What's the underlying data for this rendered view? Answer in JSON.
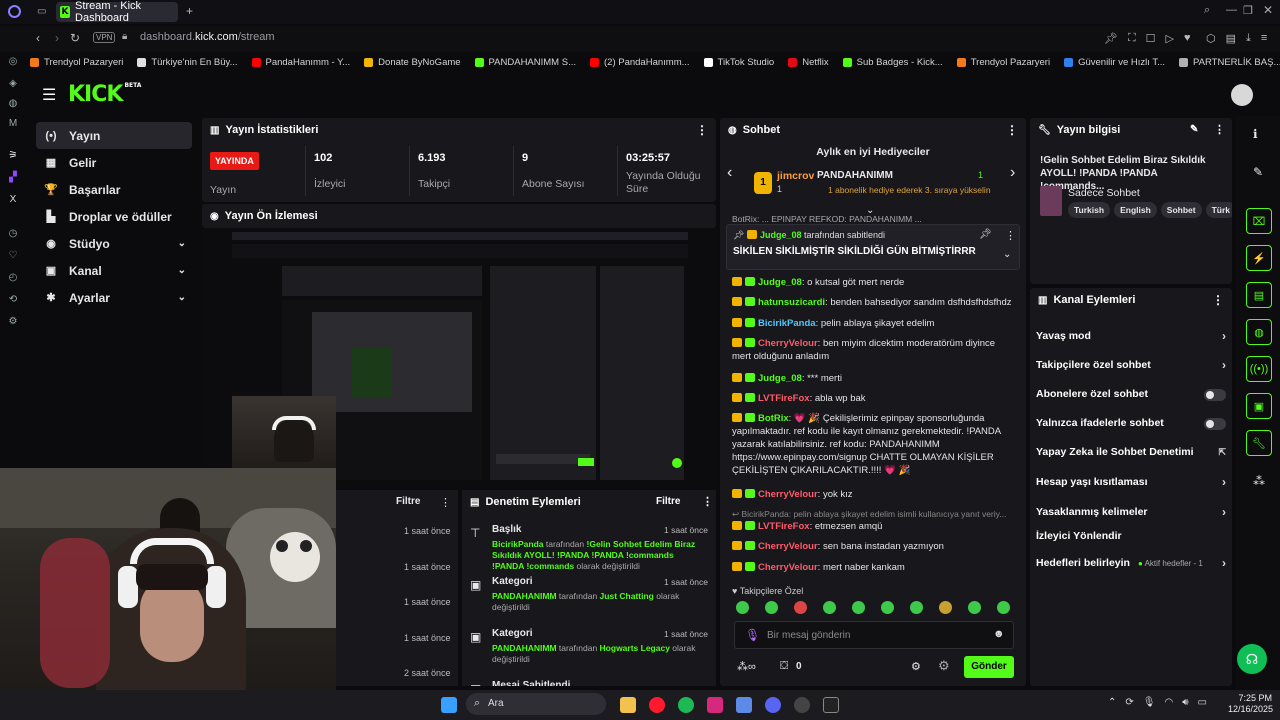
{
  "browser": {
    "tab_title": "Stream - Kick Dashboard",
    "url_prefix": "dashboard.",
    "url_domain": "kick.com",
    "url_path": "/stream",
    "vpn": "VPN",
    "bookmarks": [
      {
        "label": "Trendyol Pazaryeri",
        "color": "#f27a1a"
      },
      {
        "label": "Türkiye'nin En Büy...",
        "color": "#e0e0e0"
      },
      {
        "label": "PandaHanımm - Y...",
        "color": "#ff0000"
      },
      {
        "label": "Donate ByNoGame",
        "color": "#f4b400"
      },
      {
        "label": "PANDAHANIMM S...",
        "color": "#53fc18"
      },
      {
        "label": "(2) PandaHanımm...",
        "color": "#ff0000"
      },
      {
        "label": "TikTok Studio",
        "color": "#ffffff"
      },
      {
        "label": "Netflix",
        "color": "#e50914"
      },
      {
        "label": "Sub Badges - Kick...",
        "color": "#53fc18"
      },
      {
        "label": "Trendyol Pazaryeri",
        "color": "#f27a1a"
      },
      {
        "label": "Güvenilir ve Hızlı T...",
        "color": "#2f80ed"
      },
      {
        "label": "PARTNERLİK BAŞ...",
        "color": "#b0b0b0"
      }
    ]
  },
  "logo": {
    "text": "KICK",
    "beta": "BETA"
  },
  "nav": [
    {
      "label": "Yayın",
      "icon": "broadcast-icon",
      "glyph": "(•)",
      "active": true
    },
    {
      "label": "Gelir",
      "icon": "revenue-icon",
      "glyph": "▦"
    },
    {
      "label": "Başarılar",
      "icon": "trophy-icon",
      "glyph": "🏆"
    },
    {
      "label": "Droplar ve ödüller",
      "icon": "gift-icon",
      "glyph": "▙"
    },
    {
      "label": "Stüdyo",
      "icon": "studio-icon",
      "glyph": "◉",
      "chevron": true
    },
    {
      "label": "Kanal",
      "icon": "channel-icon",
      "glyph": "▣",
      "chevron": true
    },
    {
      "label": "Ayarlar",
      "icon": "settings-icon",
      "glyph": "✱",
      "chevron": true
    }
  ],
  "stats": {
    "title": "Yayın İstatistikleri",
    "live_badge": "YAYINDA",
    "live_label": "Yayın",
    "viewers": "102",
    "viewers_label": "İzleyici",
    "followers": "6.193",
    "followers_label": "Takipçi",
    "subs": "9",
    "subs_label": "Abone Sayısı",
    "uptime": "03:25:57",
    "uptime_label": "Yayında Olduğu Süre"
  },
  "preview": {
    "title": "Yayın Ön İzlemesi"
  },
  "activity": {
    "filter": "Filtre",
    "times": [
      "1 saat önce",
      "1 saat önce",
      "1 saat önce",
      "1 saat önce",
      "2 saat önce"
    ]
  },
  "moderation": {
    "title": "Denetim Eylemleri",
    "filter": "Filtre",
    "items": [
      {
        "type": "Başlık",
        "time": "1 saat önce",
        "user": "BicirikPanda",
        "by": " tarafından ",
        "value": "!Gelin Sohbet Edelim Biraz Sıkıldık AYOLL! !PANDA !PANDA !commands !PANDA !commands",
        "suffix": " olarak değiştirildi"
      },
      {
        "type": "Kategori",
        "time": "1 saat önce",
        "user": "PANDAHANIMM",
        "by": " tarafından ",
        "value": "Just Chatting",
        "suffix": " olarak değiştirildi"
      },
      {
        "type": "Kategori",
        "time": "1 saat önce",
        "user": "PANDAHANIMM",
        "by": " tarafından ",
        "value": "Hogwarts Legacy",
        "suffix": " olarak değiştirildi"
      },
      {
        "type": "Mesaj Sabitlendi",
        "time": "",
        "user": "",
        "by": "",
        "value": "",
        "suffix": ""
      }
    ]
  },
  "chat": {
    "title": "Sohbet",
    "gifters_title": "Aylık en iyi Hediyeciler",
    "gifter1": {
      "name": "jimcrov",
      "rank": "1"
    },
    "gifter2": {
      "name": "PANDAHANIMM",
      "count": "1"
    },
    "gifter_note": "1 abonelik hediye ederek 3. sıraya yükselin",
    "ticker": "BotRix: ... EPINPAY REFKOD: PANDAHANIMM ...",
    "pinned_by": "Judge_08",
    "pinned_suffix": " tarafından sabitlendi",
    "pinned_msg": "SİKİLEN SİKİLMİŞTİR SİKİLDİĞİ GÜN BİTMİŞTİRRR",
    "messages": [
      {
        "user": "Judge_08",
        "color": "#53fc18",
        "text": ": o kutsal göt mert nerde"
      },
      {
        "user": "hatunsuzicardi",
        "color": "#53fc18",
        "text": ": benden bahsediyor sandım dsfhdsfhdsfhdz"
      },
      {
        "user": "BicirikPanda",
        "color": "#4cc9ff",
        "text": ": pelin ablaya şikayet edelim"
      },
      {
        "user": "CherryVelour",
        "color": "#ff5b6b",
        "text": ": ben miyim dicektim moderatörüm diyince mert olduğunu anladım"
      },
      {
        "user": "Judge_08",
        "color": "#53fc18",
        "text": ": *** merti"
      },
      {
        "user": "LVTFireFox",
        "color": "#ff5b6b",
        "text": ": abla wp bak"
      },
      {
        "user": "BotRix",
        "color": "#53fc18",
        "text": ": 💗 🎉 Çekilişlerimiz epinpay sponsorluğunda yapılmaktadır. ref kodu ile kayıt olmanız gerekmektedir. !PANDA yazarak katılabilirsiniz. ref kodu: PANDAHANIMM https://www.epinpay.com/signup CHATTE OLMAYAN KİŞİLER ÇEKİLİŞTEN ÇIKARILACAKTIR.!!!! 💗 🎉"
      },
      {
        "user": "CherryVelour",
        "color": "#ff5b6b",
        "text": ": yok kız"
      },
      {
        "user": "LVTFireFox",
        "color": "#ff5b6b",
        "text": ": etmezsen amqü"
      },
      {
        "user": "CherryVelour",
        "color": "#ff5b6b",
        "text": ": sen bana instadan yazmıyon"
      },
      {
        "user": "CherryVelour",
        "color": "#ff5b6b",
        "text": ": mert naber kankam"
      }
    ],
    "reply_preview": "BicirikPanda: pelin ablaya şikayet edelim isimli kullanıcıya yanıt veriy...",
    "followers_only": "Takipçilere Özel",
    "input_placeholder": "Bir mesaj gönderin",
    "points": "0",
    "send": "Gönder"
  },
  "stream_info": {
    "title": "Yayın bilgisi",
    "stream_title": "!Gelin Sohbet Edelim Biraz Sıkıldık AYOLL! !PANDA !PANDA !commands...",
    "category": "Sadece Sohbet",
    "tags": [
      "Turkish",
      "English",
      "Sohbet",
      "Türk"
    ]
  },
  "channel_actions": {
    "title": "Kanal Eylemleri",
    "slow": "Yavaş mod",
    "followers_chat": "Takipçilere özel sohbet",
    "subs_chat": "Abonelere özel sohbet",
    "emotes_chat": "Yalnızca ifadelerle sohbet",
    "ai_mod": "Yapay Zeka ile Sohbet Denetimi",
    "age": "Hesap yaşı kısıtlaması",
    "banned": "Yasaklanmış kelimeler",
    "redirect": "İzleyici Yönlendir",
    "goals": "Hedefleri belirleyin",
    "goals_active": "Aktif hedefler - 1"
  },
  "taskbar": {
    "search": "Ara",
    "time": "7:25 PM",
    "date": "12/16/2025"
  }
}
